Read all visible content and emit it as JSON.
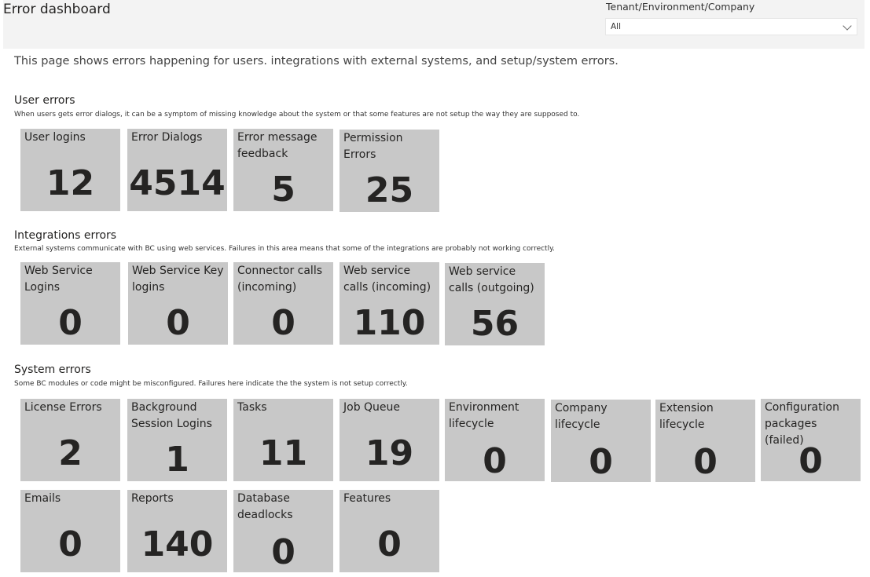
{
  "header": {
    "title": "Error dashboard",
    "filter_label": "Tenant/Environment/Company",
    "filter_value": "All"
  },
  "intro": "This page shows errors happening for users. integrations with external systems, and setup/system errors.",
  "sections": {
    "user": {
      "title": "User errors",
      "description": "When users gets error dialogs, it can be a symptom of missing knowledge about the system or that some features are not setup the way they are supposed to.",
      "cards": [
        {
          "label": "User logins",
          "value": "12"
        },
        {
          "label": "Error Dialogs",
          "value": "4514"
        },
        {
          "label": "Error message feedback",
          "value": "5"
        },
        {
          "label": "Permission Errors",
          "value": "25"
        }
      ]
    },
    "integrations": {
      "title": "Integrations errors",
      "description": "External systems communicate with BC using web services. Failures in this area means that some of the integrations are probably not working correctly.",
      "cards": [
        {
          "label": "Web Service Logins",
          "value": "0"
        },
        {
          "label": "Web Service Key logins",
          "value": "0"
        },
        {
          "label": "Connector calls (incoming)",
          "value": "0"
        },
        {
          "label": "Web service calls (incoming)",
          "value": "110"
        },
        {
          "label": "Web service calls (outgoing)",
          "value": "56"
        }
      ]
    },
    "system": {
      "title": "System errors",
      "description": "Some BC modules or code might be misconfigured. Failures here indicate the the system is not setup correctly.",
      "cards": [
        {
          "label": "License Errors",
          "value": "2"
        },
        {
          "label": "Background Session Logins",
          "value": "1"
        },
        {
          "label": "Tasks",
          "value": "11"
        },
        {
          "label": "Job Queue",
          "value": "19"
        },
        {
          "label": "Environment lifecycle",
          "value": "0"
        },
        {
          "label": "Company lifecycle",
          "value": "0"
        },
        {
          "label": "Extension lifecycle",
          "value": "0"
        },
        {
          "label": "Configuration packages (failed)",
          "value": "0"
        },
        {
          "label": "Emails",
          "value": "0"
        },
        {
          "label": "Reports",
          "value": "140"
        },
        {
          "label": "Database deadlocks",
          "value": "0"
        },
        {
          "label": "Features",
          "value": "0"
        }
      ]
    }
  }
}
